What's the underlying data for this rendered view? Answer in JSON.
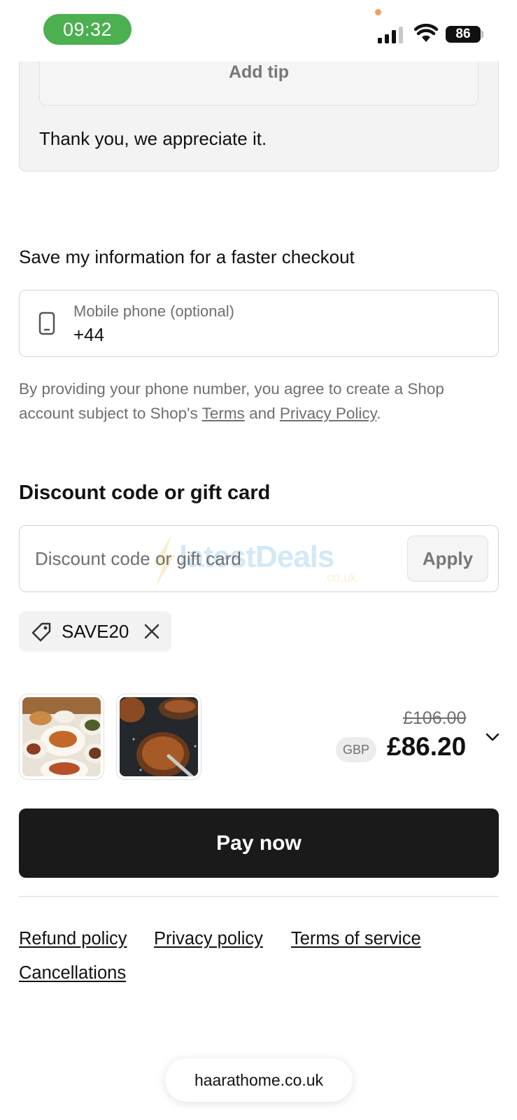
{
  "status_bar": {
    "time": "09:32",
    "battery": "86"
  },
  "tip": {
    "add_tip_label": "Add tip",
    "thanks_text": "Thank you, we appreciate it."
  },
  "save_info": {
    "heading": "Save my information for a faster checkout",
    "phone_label": "Mobile phone (optional)",
    "phone_value": "+44",
    "consent_prefix": "By providing your phone number, you agree to create a Shop account subject to Shop's ",
    "terms_link": "Terms",
    "consent_and": " and ",
    "privacy_link": "Privacy Policy",
    "consent_suffix": "."
  },
  "discount": {
    "heading": "Discount code or gift card",
    "placeholder": "Discount code or gift card",
    "apply_label": "Apply",
    "watermark_text": "latestDeals",
    "watermark_sub": ".co.uk",
    "applied_code": "SAVE20"
  },
  "order_summary": {
    "original_price": "£106.00",
    "currency": "GBP",
    "total": "£86.20"
  },
  "pay_button_label": "Pay now",
  "footer_links": {
    "refund": "Refund policy",
    "privacy": "Privacy policy",
    "terms": "Terms of service",
    "cancellations": "Cancellations"
  },
  "browser": {
    "url": "haarathome.co.uk"
  }
}
